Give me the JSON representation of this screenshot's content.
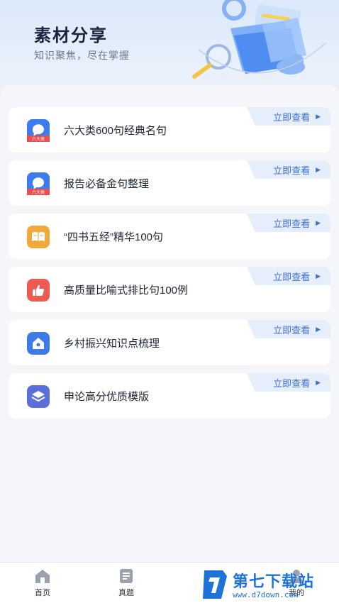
{
  "header": {
    "title": "素材分享",
    "subtitle": "知识聚焦，尽在掌握"
  },
  "cards": [
    {
      "title": "六大类600句经典名句",
      "action": "立即查看",
      "icon": "speech-bubble-icon",
      "icon_color": "#3c7cf0",
      "icon_caption": "六大类"
    },
    {
      "title": "报告必备金句整理",
      "action": "立即查看",
      "icon": "speech-bubble-icon",
      "icon_color": "#3c7cf0",
      "icon_caption": "六大类"
    },
    {
      "title": "“四书五经”精华100句",
      "action": "立即查看",
      "icon": "book-icon",
      "icon_color": "#f2a93b"
    },
    {
      "title": "高质量比喻式排比句100例",
      "action": "立即查看",
      "icon": "thumbs-up-icon",
      "icon_color": "#ee5a52"
    },
    {
      "title": "乡村振兴知识点梳理",
      "action": "立即查看",
      "icon": "house-icon",
      "icon_color": "#3d7be8"
    },
    {
      "title": "申论高分优质模版",
      "action": "立即查看",
      "icon": "layers-icon",
      "icon_color": "#5b6fd9"
    }
  ],
  "tabbar": {
    "items": [
      {
        "label": "首页",
        "icon": "home-icon"
      },
      {
        "label": "真题",
        "icon": "document-icon"
      },
      {
        "label": "我的",
        "icon": "user-icon"
      }
    ]
  },
  "watermark": {
    "name": "第七下载站",
    "url": "www.d7down.com"
  },
  "colors": {
    "accent": "#3d6fd8",
    "tag_bg": "#e6eefb",
    "page_bg": "#eef1f7"
  }
}
